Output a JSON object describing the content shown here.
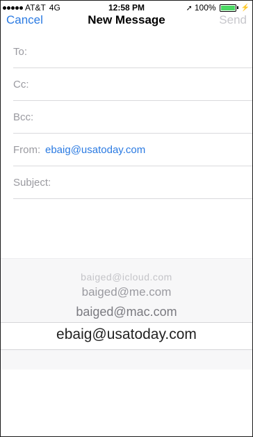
{
  "status_bar": {
    "carrier": "AT&T",
    "network": "4G",
    "time": "12:58 PM",
    "battery": "100%"
  },
  "nav": {
    "cancel_label": "Cancel",
    "title": "New Message",
    "send_label": "Send"
  },
  "fields": {
    "to_label": "To:",
    "cc_label": "Cc:",
    "bcc_label": "Bcc:",
    "from_label": "From:",
    "from_value": "ebaig@usatoday.com",
    "subject_label": "Subject:"
  },
  "picker": {
    "options": [
      "baiged@icloud.com",
      "baiged@me.com",
      "baiged@mac.com",
      "ebaig@usatoday.com"
    ],
    "selected": "ebaig@usatoday.com"
  },
  "colors": {
    "accent": "#2a7ae2",
    "battery": "#4cd964"
  },
  "icons": [
    "signal-dots-icon",
    "location-arrow-icon",
    "battery-icon",
    "charging-bolt-icon"
  ]
}
